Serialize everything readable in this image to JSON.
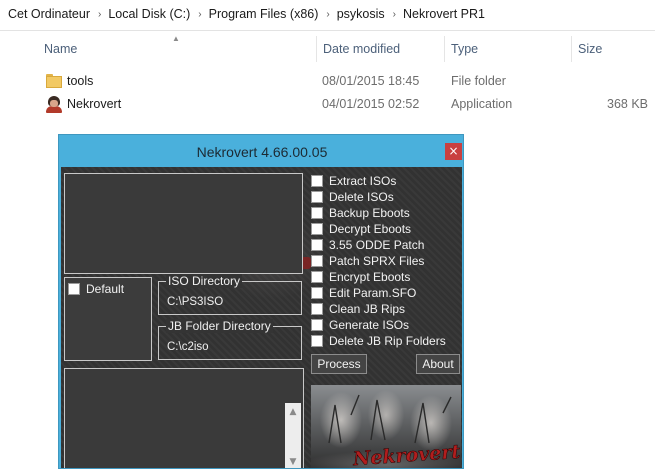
{
  "explorer": {
    "breadcrumb": [
      "Cet Ordinateur",
      "Local Disk (C:)",
      "Program Files (x86)",
      "psykosis",
      "Nekrovert PR1"
    ],
    "separator": "›",
    "columns": {
      "name": "Name",
      "date": "Date modified",
      "type": "Type",
      "size": "Size"
    },
    "sort_indicator": "▲",
    "files": [
      {
        "name": "tools",
        "date": "08/01/2015 18:45",
        "type": "File folder",
        "size": "",
        "icon": "folder-icon"
      },
      {
        "name": "Nekrovert",
        "date": "04/01/2015 02:52",
        "type": "Application",
        "size": "368 KB",
        "icon": "application-icon"
      }
    ]
  },
  "nekrovert": {
    "title": "Nekrovert 4.66.00.05",
    "close_glyph": "×",
    "default_label": "Default",
    "iso_directory": {
      "label": "ISO Directory",
      "path": "C:\\PS3ISO"
    },
    "jb_directory": {
      "label": "JB Folder Directory",
      "path": "C:\\c2iso"
    },
    "options": [
      "Extract ISOs",
      "Delete ISOs",
      "Backup Eboots",
      "Decrypt Eboots",
      "3.55 ODDE Patch",
      "Patch SPRX Files",
      "Encrypt Eboots",
      "Edit Param.SFO",
      "Clean JB Rips",
      "Generate ISOs",
      "Delete JB Rip Folders"
    ],
    "buttons": {
      "process": "Process",
      "about": "About"
    },
    "logo_text": "Nekrovert",
    "scroll_up": "▲",
    "scroll_down": "▼",
    "colors": {
      "titlebar": "#4ab0dc",
      "close": "#c94040",
      "client": "#343434"
    }
  }
}
